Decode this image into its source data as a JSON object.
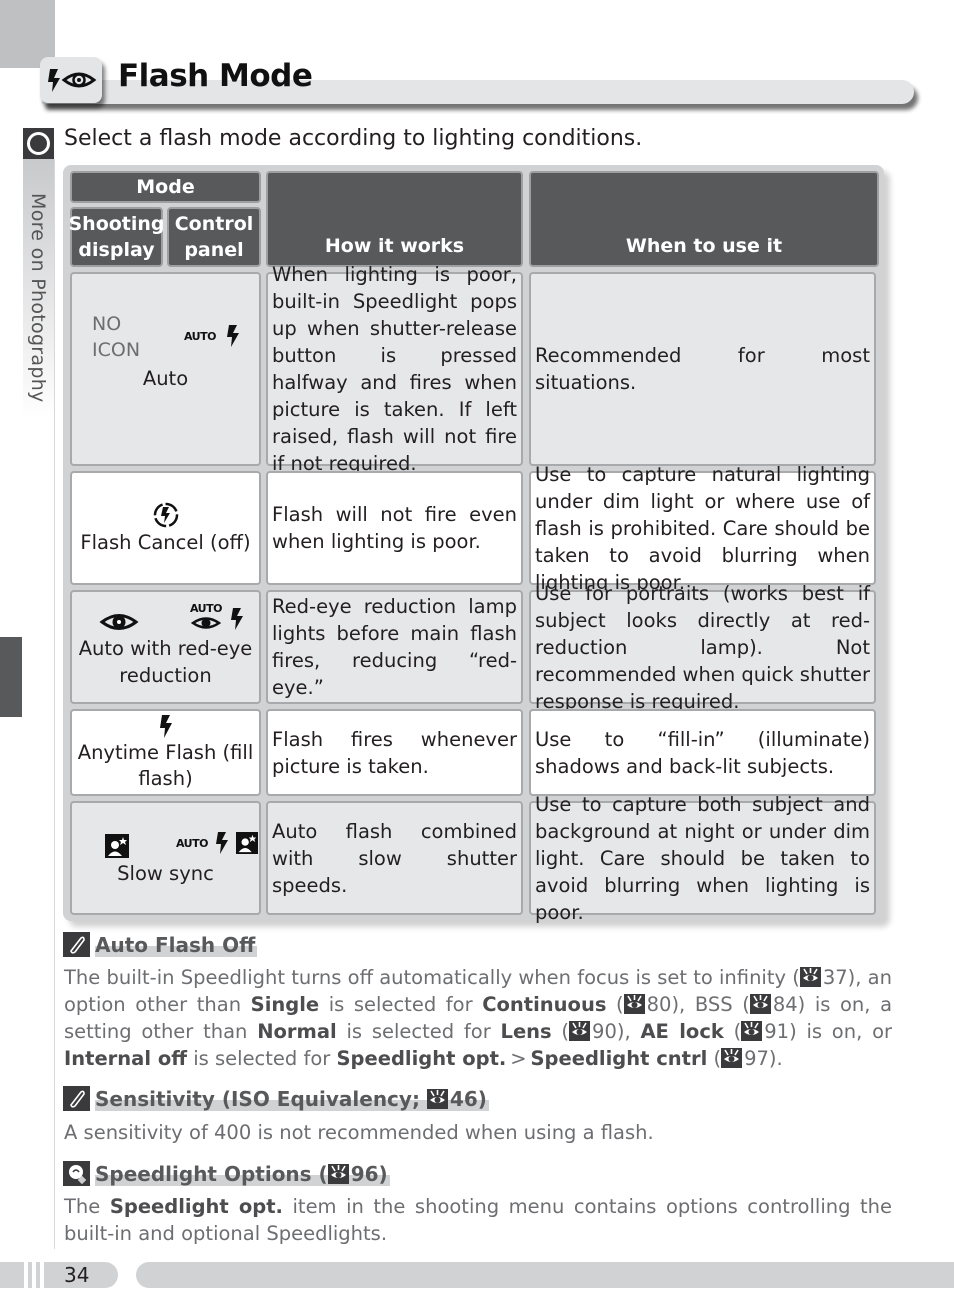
{
  "page": {
    "title": "Flash Mode",
    "title_icons": [
      "flash-icon",
      "red-eye-icon"
    ],
    "side_tab_label": "More on Photography",
    "intro": "Select a flash mode according to lighting conditions.",
    "page_number": "34"
  },
  "table": {
    "headers": {
      "mode": "Mode",
      "shooting_display": "Shooting display",
      "control_panel": "Control panel",
      "how": "How it works",
      "when": "When to use it"
    },
    "rows": [
      {
        "shooting_display_icon": "NO ICON",
        "control_panel_icon": "auto-flash-icon",
        "control_panel_text": "AUTO",
        "name": "Auto",
        "how": "When lighting is poor, built-in Speedlight pops up when shutter-release button is pressed halfway and fires when picture is taken. If left raised, flash will not fire if not required.",
        "when": "Recommended for most situations."
      },
      {
        "icon": "flash-cancel-icon",
        "name": "Flash Cancel (off)",
        "how": "Flash will not fire even when lighting is poor.",
        "when": "Use to capture natural lighting under dim light or where use of flash is prohibited.  Care should be taken to avoid blurring when lighting is poor."
      },
      {
        "shooting_display_icon": "red-eye-icon",
        "control_panel_icon": "auto-red-eye-flash-icon",
        "control_panel_text": "AUTO",
        "name": "Auto with red-eye reduction",
        "how": "Red-eye reduction lamp lights before main flash fires, reducing “red-eye.”",
        "when": "Use for portraits (works best if subject looks directly at red-reduction lamp).  Not recommended when quick shutter response is required."
      },
      {
        "icon": "flash-icon",
        "name": "Anytime Flash (fill flash)",
        "how": "Flash fires whenever picture is taken.",
        "when": "Use to “fill-in” (illuminate) shadows and back-lit subjects."
      },
      {
        "shooting_display_icon": "night-portrait-icon",
        "control_panel_icon": "auto-flash-night-portrait-icon",
        "control_panel_text": "AUTO",
        "name": "Slow sync",
        "how": "Auto flash combined with slow shutter speeds.",
        "when": "Use to capture both subject and background at night or under dim light.  Care should be taken to avoid blurring when lighting is poor."
      }
    ]
  },
  "notes": [
    {
      "icon": "pencil-note-icon",
      "title": "Auto Flash Off",
      "body": [
        {
          "t": "The built-in Speedlight turns off automatically when focus is set to infinity ("
        },
        {
          "ref": "37"
        },
        {
          "t": "), an option other than "
        },
        {
          "b": "Single"
        },
        {
          "t": " is selected for "
        },
        {
          "b": "Continuous"
        },
        {
          "t": " ("
        },
        {
          "ref": "80"
        },
        {
          "t": "), BSS ("
        },
        {
          "ref": "84"
        },
        {
          "t": ") is on, a setting other than "
        },
        {
          "b": "Normal"
        },
        {
          "t": " is selected for "
        },
        {
          "b": "Lens"
        },
        {
          "t": " ("
        },
        {
          "ref": "90"
        },
        {
          "t": "), "
        },
        {
          "b": "AE lock"
        },
        {
          "t": " ("
        },
        {
          "ref": "91"
        },
        {
          "t": ") is on, or "
        },
        {
          "b": "Internal off"
        },
        {
          "t": " is selected for "
        },
        {
          "b": "Speedlight opt."
        },
        {
          "t": " > "
        },
        {
          "b": "Speedlight cntrl"
        },
        {
          "t": " ("
        },
        {
          "ref": "97"
        },
        {
          "t": ")."
        }
      ]
    },
    {
      "icon": "pencil-note-icon",
      "title_parts": [
        {
          "t": "Sensitivity (ISO Equivalency; "
        },
        {
          "ref": "46"
        },
        {
          "t": ")"
        }
      ],
      "body": [
        {
          "t": "A sensitivity of 400 is not recommended when using a flash."
        }
      ]
    },
    {
      "icon": "lightbulb-tip-icon",
      "title_parts": [
        {
          "t": "Speedlight Options ("
        },
        {
          "ref": "96"
        },
        {
          "t": ")"
        }
      ],
      "body": [
        {
          "t": "The "
        },
        {
          "b": "Speedlight opt."
        },
        {
          "t": " item in the shooting menu contains options controlling the built-in and optional Speedlights."
        }
      ]
    }
  ],
  "colors": {
    "header_cell": "#58595b",
    "shaded_cell": "#e6e7e8",
    "frame": "#d1d2d4",
    "note_text": "#6d6e71"
  }
}
